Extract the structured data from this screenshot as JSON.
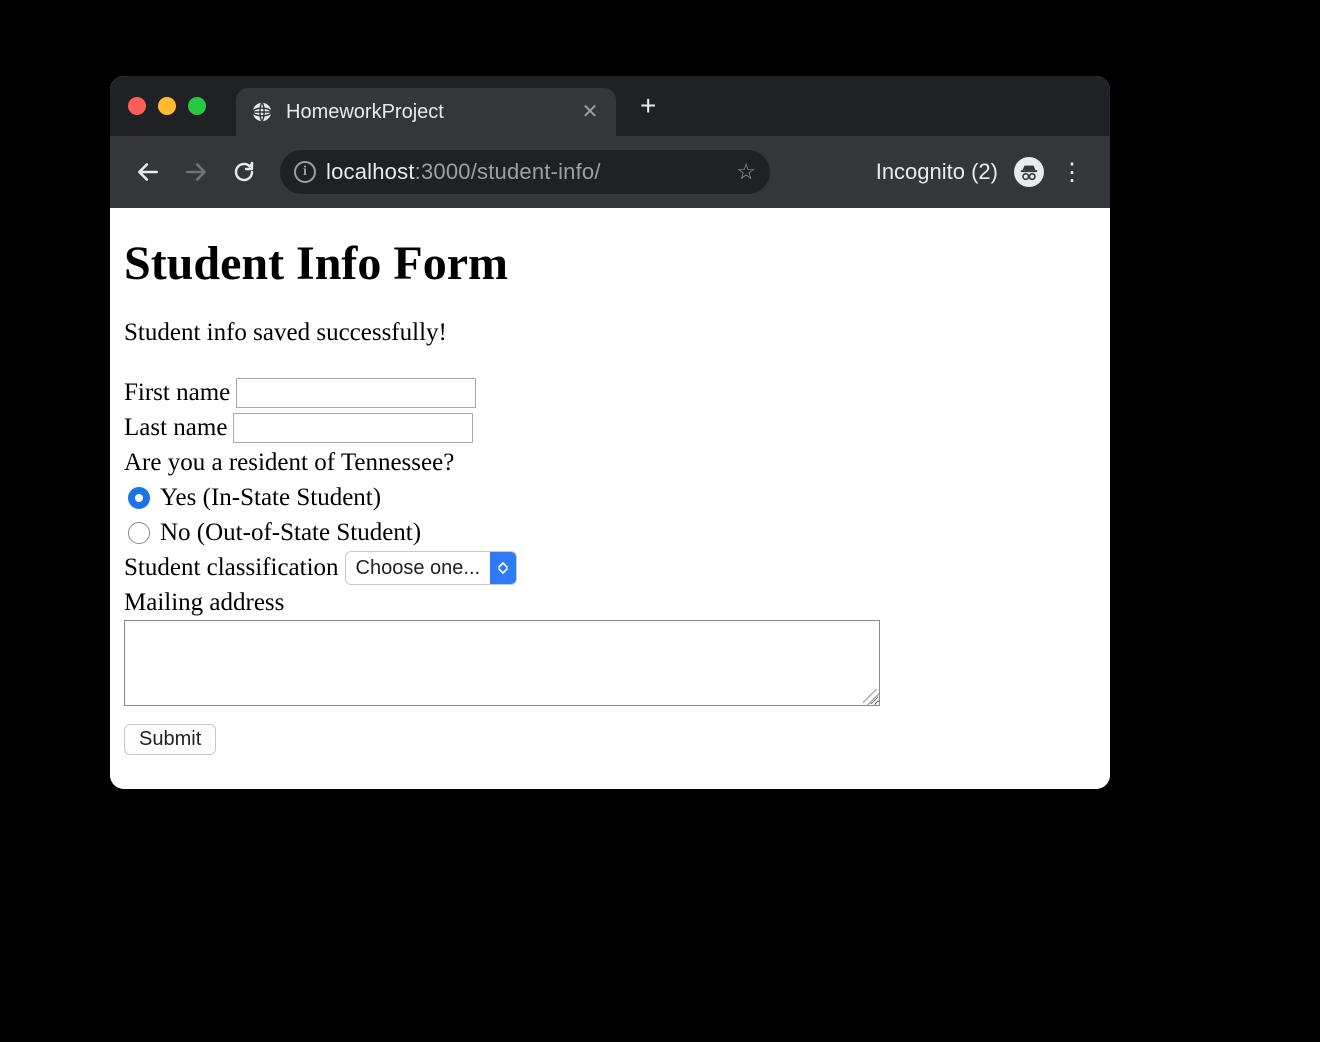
{
  "browser": {
    "tab_title": "HomeworkProject",
    "url_host": "localhost",
    "url_port_path": ":3000/student-info/",
    "incognito_label": "Incognito (2)"
  },
  "page": {
    "heading": "Student Info Form",
    "status_message": "Student info saved successfully!",
    "first_name_label": "First name",
    "first_name_value": "",
    "last_name_label": "Last name",
    "last_name_value": "",
    "residency_question": "Are you a resident of Tennessee?",
    "radio_yes_label": "Yes (In-State Student)",
    "radio_no_label": "No (Out-of-State Student)",
    "residency_selected": "yes",
    "classification_label": "Student classification",
    "classification_selected": "Choose one...",
    "mailing_address_label": "Mailing address",
    "mailing_address_value": "",
    "submit_label": "Submit"
  }
}
